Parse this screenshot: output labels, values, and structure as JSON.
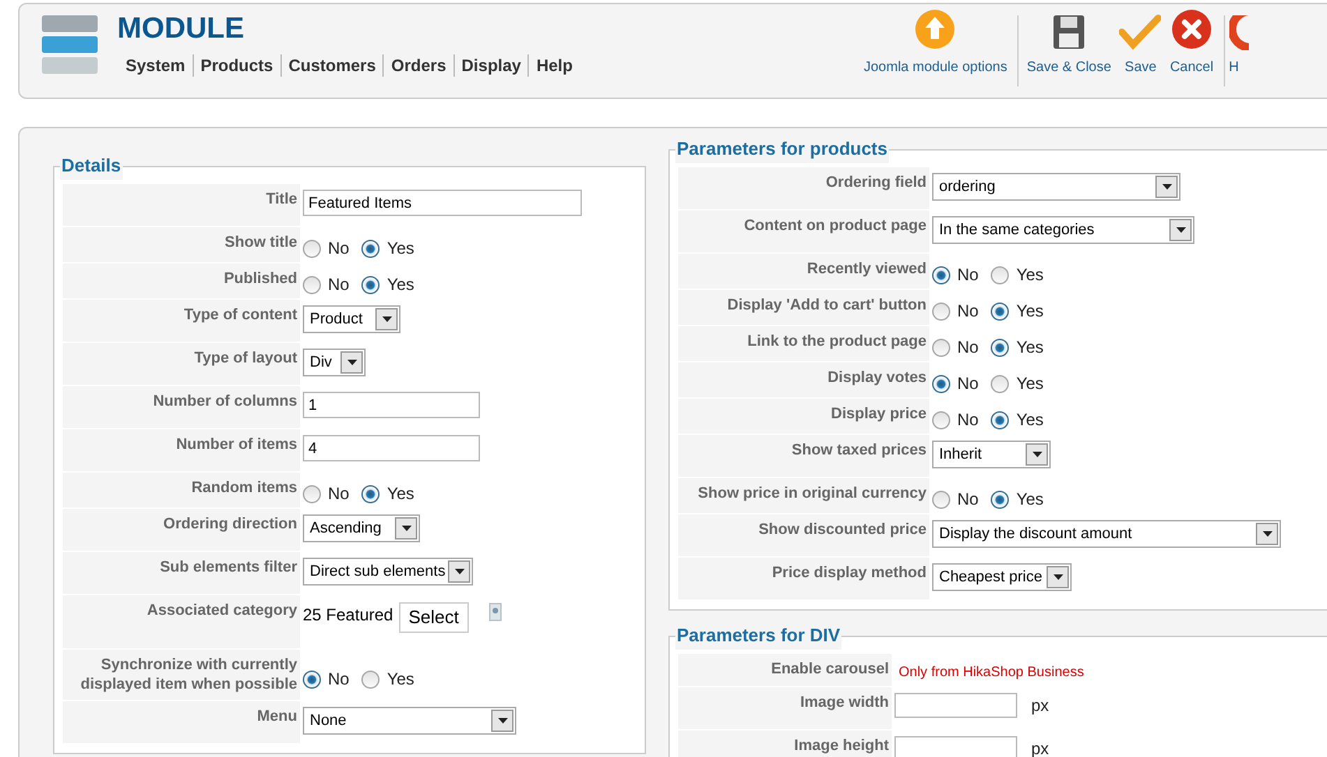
{
  "header": {
    "title": "MODULE",
    "menu": [
      "System",
      "Products",
      "Customers",
      "Orders",
      "Display",
      "Help"
    ]
  },
  "toolbar": [
    {
      "kind": "options",
      "label": "Joomla module options"
    },
    {
      "kind": "save-close",
      "label": "Save & Close"
    },
    {
      "kind": "save",
      "label": "Save"
    },
    {
      "kind": "cancel",
      "label": "Cancel"
    },
    {
      "kind": "help",
      "label": "H"
    }
  ],
  "details": {
    "legend": "Details",
    "rows": [
      {
        "kind": "text",
        "label": "Title",
        "value": "Featured Items"
      },
      {
        "kind": "radio",
        "label": "Show title",
        "options": [
          {
            "label": "No",
            "selected": false
          },
          {
            "label": "Yes",
            "selected": true
          }
        ]
      },
      {
        "kind": "radio",
        "label": "Published",
        "options": [
          {
            "label": "No",
            "selected": false
          },
          {
            "label": "Yes",
            "selected": true
          }
        ]
      },
      {
        "kind": "select",
        "label": "Type of content",
        "value": "Product"
      },
      {
        "kind": "select",
        "label": "Type of layout",
        "value": "Div"
      },
      {
        "kind": "text",
        "label": "Number of columns",
        "value": "1"
      },
      {
        "kind": "text",
        "label": "Number of items",
        "value": "4"
      },
      {
        "kind": "radio",
        "label": "Random items",
        "options": [
          {
            "label": "No",
            "selected": false
          },
          {
            "label": "Yes",
            "selected": true
          }
        ]
      },
      {
        "kind": "select",
        "label": "Ordering direction",
        "value": "Ascending"
      },
      {
        "kind": "select",
        "label": "Sub elements filter",
        "value": "Direct sub elements"
      },
      {
        "kind": "category",
        "label": "Associated category",
        "value": "25 Featured",
        "button": "Select"
      },
      {
        "kind": "radio",
        "label": "Synchronize with currently displayed item when possible",
        "options": [
          {
            "label": "No",
            "selected": true
          },
          {
            "label": "Yes",
            "selected": false
          }
        ]
      },
      {
        "kind": "select",
        "label": "Menu",
        "value": "None"
      }
    ]
  },
  "products": {
    "legend": "Parameters for products",
    "rows": [
      {
        "kind": "select",
        "label": "Ordering field",
        "value": "ordering"
      },
      {
        "kind": "select",
        "label": "Content on product page",
        "value": "In the same categories"
      },
      {
        "kind": "radio",
        "label": "Recently viewed",
        "options": [
          {
            "label": "No",
            "selected": true
          },
          {
            "label": "Yes",
            "selected": false
          }
        ]
      },
      {
        "kind": "radio",
        "label": "Display 'Add to cart' button",
        "options": [
          {
            "label": "No",
            "selected": false
          },
          {
            "label": "Yes",
            "selected": true
          }
        ]
      },
      {
        "kind": "radio",
        "label": "Link to the product page",
        "options": [
          {
            "label": "No",
            "selected": false
          },
          {
            "label": "Yes",
            "selected": true
          }
        ]
      },
      {
        "kind": "radio",
        "label": "Display votes",
        "options": [
          {
            "label": "No",
            "selected": true
          },
          {
            "label": "Yes",
            "selected": false
          }
        ]
      },
      {
        "kind": "radio",
        "label": "Display price",
        "options": [
          {
            "label": "No",
            "selected": false
          },
          {
            "label": "Yes",
            "selected": true
          }
        ]
      },
      {
        "kind": "select",
        "label": "Show taxed prices",
        "value": "Inherit"
      },
      {
        "kind": "radio",
        "label": "Show price in original currency",
        "options": [
          {
            "label": "No",
            "selected": false
          },
          {
            "label": "Yes",
            "selected": true
          }
        ]
      },
      {
        "kind": "select",
        "label": "Show discounted price",
        "value": "Display the discount amount"
      },
      {
        "kind": "select",
        "label": "Price display method",
        "value": "Cheapest price"
      }
    ]
  },
  "div": {
    "legend": "Parameters for DIV",
    "rows": [
      {
        "kind": "note",
        "label": "Enable carousel",
        "value": "Only from HikaShop Business"
      },
      {
        "kind": "unit",
        "label": "Image width",
        "unit": "px"
      },
      {
        "kind": "unit",
        "label": "Image height",
        "unit": "px"
      }
    ]
  }
}
